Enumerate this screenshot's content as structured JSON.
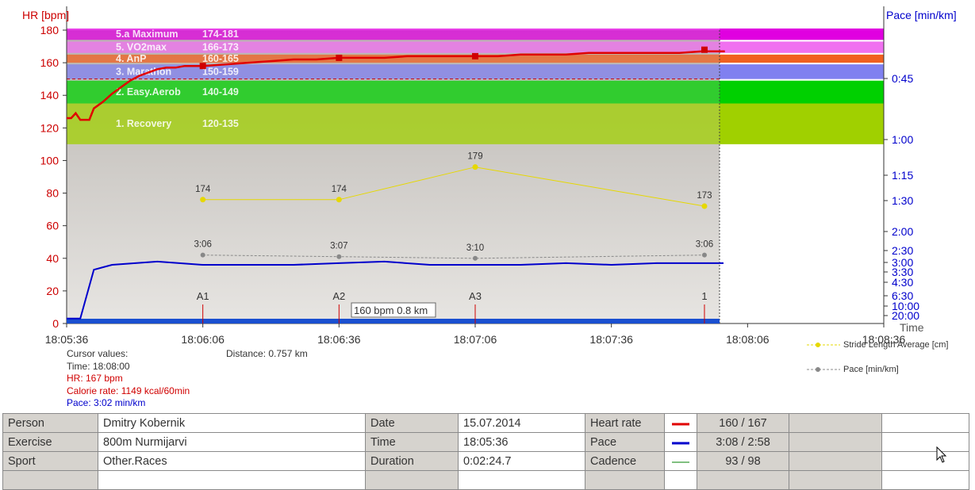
{
  "colors": {
    "hr": "#e00000",
    "pace": "#0000cc",
    "stride": "#e6d800",
    "paceavg": "#888888",
    "plot_bg": "#c6c2bd",
    "zone_max": "#e000e0",
    "zone_vo2": "#f070f0",
    "zone_anp": "#f06020",
    "zone_mara": "#8080f0",
    "zone_easy": "#00d000",
    "zone_rec": "#a0d000"
  },
  "chart_data": {
    "type": "line",
    "x_axis_ticks": [
      "18:05:36",
      "18:06:06",
      "18:06:36",
      "18:07:06",
      "18:07:36",
      "18:08:06",
      "18:08:36"
    ],
    "x_label": "Time",
    "y_left_label": "HR [bpm]",
    "y_left_ticks": [
      "0",
      "20",
      "40",
      "60",
      "80",
      "100",
      "120",
      "140",
      "160",
      "180"
    ],
    "ylim_left": [
      0,
      180
    ],
    "y_right_label": "Pace [min/km]",
    "y_right_ticks": [
      "0:45",
      "1:00",
      "1:15",
      "1:30",
      "2:00",
      "2:30",
      "3:00",
      "3:30",
      "4:30",
      "6:30",
      "10:00",
      "20:00"
    ],
    "zones": [
      {
        "name": "5.a Maximum",
        "range": "174-181",
        "lo": 174,
        "hi": 181
      },
      {
        "name": "5. VO2max",
        "range": "166-173",
        "lo": 166,
        "hi": 173
      },
      {
        "name": "4. AnP",
        "range": "160-165",
        "lo": 160,
        "hi": 165
      },
      {
        "name": "3. Marathon",
        "range": "150-159",
        "lo": 150,
        "hi": 159
      },
      {
        "name": "2. Easy.Aerob",
        "range": "140-149",
        "lo": 135,
        "hi": 149
      },
      {
        "name": "1. Recovery",
        "range": "120-135",
        "lo": 110,
        "hi": 135
      }
    ],
    "series": [
      {
        "name": "HR",
        "axis": "left",
        "x": [
          0,
          1,
          2,
          3,
          4,
          5,
          6,
          8,
          10,
          12,
          14,
          16,
          18,
          20,
          22,
          24,
          26,
          28,
          30,
          35,
          40,
          45,
          50,
          55,
          60,
          65,
          70,
          75,
          80,
          85,
          90,
          95,
          100,
          105,
          110,
          115,
          120,
          125,
          130,
          135,
          140,
          145,
          144.7
        ],
        "y": [
          126,
          126,
          129,
          125,
          125,
          125,
          132,
          136,
          141,
          145,
          149,
          152,
          154,
          156,
          157,
          157,
          158,
          158,
          158,
          159,
          160,
          161,
          162,
          162,
          163,
          163,
          163,
          164,
          164,
          164,
          164,
          164,
          165,
          165,
          165,
          166,
          166,
          166,
          166,
          166,
          167,
          167,
          167
        ]
      },
      {
        "name": "Pace",
        "axis": "left",
        "x": [
          0,
          3,
          6,
          10,
          20,
          30,
          40,
          50,
          60,
          70,
          80,
          90,
          100,
          110,
          120,
          130,
          140,
          144.7
        ],
        "y": [
          3,
          3,
          33,
          36,
          38,
          36,
          36,
          36,
          37,
          38,
          36,
          36,
          36,
          37,
          36,
          37,
          37,
          37
        ]
      }
    ],
    "stride_points": {
      "x": [
        0,
        20.6,
        42.4,
        65.4,
        86.8
      ],
      "y": [
        76,
        76,
        96,
        72
      ],
      "labels": [
        "174",
        "174",
        "179",
        "173"
      ]
    },
    "pace_points": {
      "labels": [
        "3:06",
        "3:07",
        "3:10",
        "3:06"
      ],
      "y": [
        42,
        41,
        40,
        42
      ]
    },
    "laps": [
      "A1",
      "A2",
      "A3",
      "1"
    ],
    "lap_x": [
      30,
      60,
      90,
      140.5
    ],
    "cursor_label": "160 bpm 0.8 km"
  },
  "cursor_values": {
    "title": "Cursor values:",
    "time": "Time: 18:08:00",
    "hr": "HR: 167 bpm",
    "calorie": "Calorie rate: 1149 kcal/60min",
    "pace": "Pace: 3:02 min/km"
  },
  "distance": "Distance: 0.757 km",
  "legend": {
    "stride": "Stride Length Average [cm]",
    "pace": "Pace [min/km]"
  },
  "table": {
    "rows": [
      {
        "l1": "Person",
        "v1": "Dmitry Kobernik",
        "l2": "Date",
        "v2": "15.07.2014",
        "l3": "Heart rate",
        "sw": "#e00000",
        "v3": "160 / 167"
      },
      {
        "l1": "Exercise",
        "v1": "800m Nurmijarvi",
        "l2": "Time",
        "v2": "18:05:36",
        "l3": "Pace",
        "sw": "#0000cc",
        "v3": "3:08 / 2:58"
      },
      {
        "l1": "Sport",
        "v1": "Other.Races",
        "l2": "Duration",
        "v2": "0:02:24.7",
        "l3": "Cadence",
        "sw": "#008000",
        "v3": "93 / 98"
      },
      {
        "l1": "",
        "v1": "",
        "l2": "",
        "v2": "",
        "l3": "",
        "sw": "",
        "v3": ""
      }
    ]
  }
}
